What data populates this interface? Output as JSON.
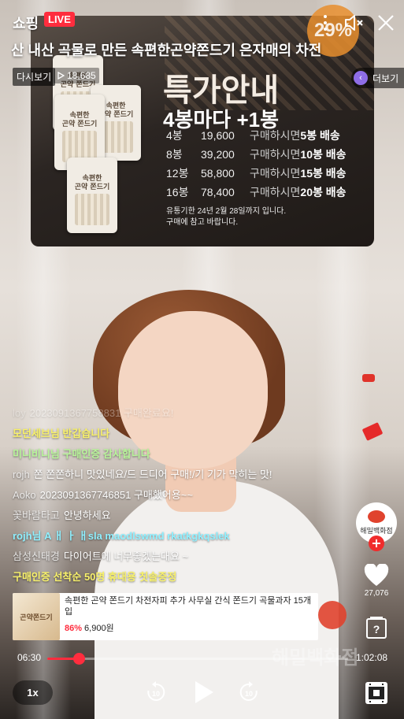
{
  "topbar": {
    "brand": "쇼핑",
    "live": "LIVE",
    "discount": "29%",
    "title_marquee": "산 내산 곡물로 만든 속편한곤약쫀드기      은자매의 차전",
    "replay": "다시보기",
    "views": "18,685",
    "more": "더보기",
    "icons": [
      "more-vertical-icon",
      "speaker-mute-icon",
      "close-icon"
    ]
  },
  "promo": {
    "title": "특가안내",
    "subtitle": "4봉마다 +1봉",
    "pack_label": "속편한\n곤약 쫀드기",
    "rows": [
      {
        "qty": "4봉",
        "price": "19,600",
        "text": "구매하시면",
        "deliver": "5봉 배송"
      },
      {
        "qty": "8봉",
        "price": "39,200",
        "text": "구매하시면",
        "deliver": "10봉 배송"
      },
      {
        "qty": "12봉",
        "price": "58,800",
        "text": "구매하시면",
        "deliver": "15봉 배송"
      },
      {
        "qty": "16봉",
        "price": "78,400",
        "text": "구매하시면",
        "deliver": "20봉 배송"
      }
    ],
    "note_1": "유통기한 24년 2월 28일까지 입니다.",
    "note_2": "구매에 참고 바랍니다."
  },
  "chat": [
    {
      "nick": "loy",
      "msg": "2023091367758831 구매완료요!",
      "style": "faded"
    },
    {
      "nick": "",
      "msg": "모던세브님 반갑습니다",
      "style": "hl-yellow"
    },
    {
      "nick": "",
      "msg": "미니비니님 구매인증 감사합니다",
      "style": "hl-green"
    },
    {
      "nick": "rojh",
      "msg": "쫀 쫀쫀하니 맛있네요/드 드디어 구매!/기 기가 막히는 맛!",
      "style": ""
    },
    {
      "nick": "Aoko",
      "msg": "2023091367746851 구매했어용~~",
      "style": ""
    },
    {
      "nick": "꽃바람타고",
      "msg": "안녕하세요",
      "style": ""
    },
    {
      "nick": "",
      "msg": "rojh님 A ㅐ ㅏ ㅐsla maodlswmd rkatkgkqslek",
      "style": "hl-cyan"
    },
    {
      "nick": "삼성신태경",
      "msg": "다이어트에 너무좋겠는대요 ~",
      "style": ""
    },
    {
      "nick": "",
      "msg": "구매인증 선착순 50명 휴대용 칫솔증정",
      "style": "hl-yellow"
    }
  ],
  "rail": {
    "store_name": "해밀백화점",
    "likes": "27,076"
  },
  "product": {
    "thumb_label": "곤약쫀드기",
    "name": "속편한 곤약 쫀드기 차전자피 추가 사무실 간식 쫀드기 곡물과자 15개입",
    "discount": "86%",
    "price": "6,900원"
  },
  "watermark": "해밀백화점",
  "player": {
    "current": "06:30",
    "total": "1:02:08",
    "progress": 0.1046,
    "speed": "1x",
    "icons": [
      "rewind-10-icon",
      "play-icon",
      "forward-10-icon",
      "fullscreen-icon"
    ]
  }
}
